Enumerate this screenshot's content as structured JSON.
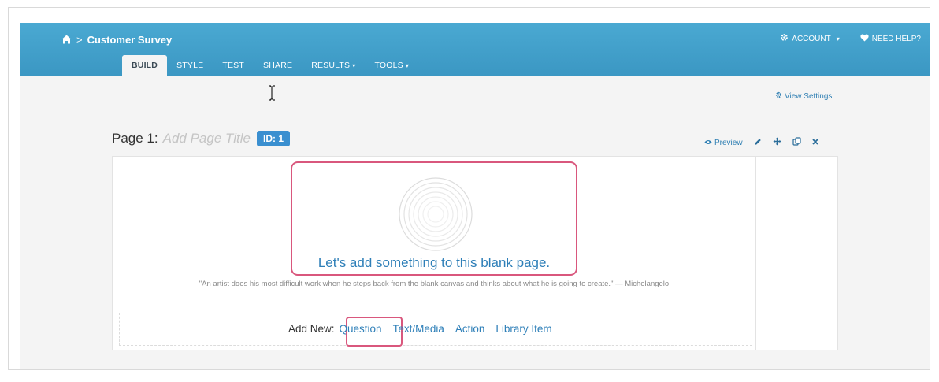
{
  "header": {
    "breadcrumb_sep": ">",
    "survey_title": "Customer Survey",
    "tabs": [
      {
        "label": "BUILD"
      },
      {
        "label": "STYLE"
      },
      {
        "label": "TEST"
      },
      {
        "label": "SHARE"
      },
      {
        "label": "RESULTS",
        "caret": "▾"
      },
      {
        "label": "TOOLS",
        "caret": "▾"
      }
    ],
    "account_label": "ACCOUNT",
    "account_caret": "▾",
    "help_label": "NEED HELP?"
  },
  "toolbar": {
    "view_settings": "View Settings"
  },
  "page": {
    "label": "Page 1:",
    "title_placeholder": "Add Page Title",
    "id_badge": "ID: 1",
    "preview_label": "Preview"
  },
  "blank_state": {
    "message": "Let's add something to this blank page.",
    "quote": "\"An artist does his most difficult work when he steps back from the blank canvas and thinks about what he is going to create.\" — Michelangelo"
  },
  "add_new": {
    "label": "Add New:",
    "options": [
      "Question",
      "Text/Media",
      "Action",
      "Library Item"
    ]
  },
  "colors": {
    "header": "#3ea0cc",
    "highlight": "#d9577d",
    "link": "#2e7fb8",
    "badge": "#3a8fd0"
  },
  "icons": [
    "home-icon",
    "gear-icon",
    "heart-icon",
    "eye-icon",
    "pencil-icon",
    "move-icon",
    "copy-icon",
    "close-icon"
  ]
}
